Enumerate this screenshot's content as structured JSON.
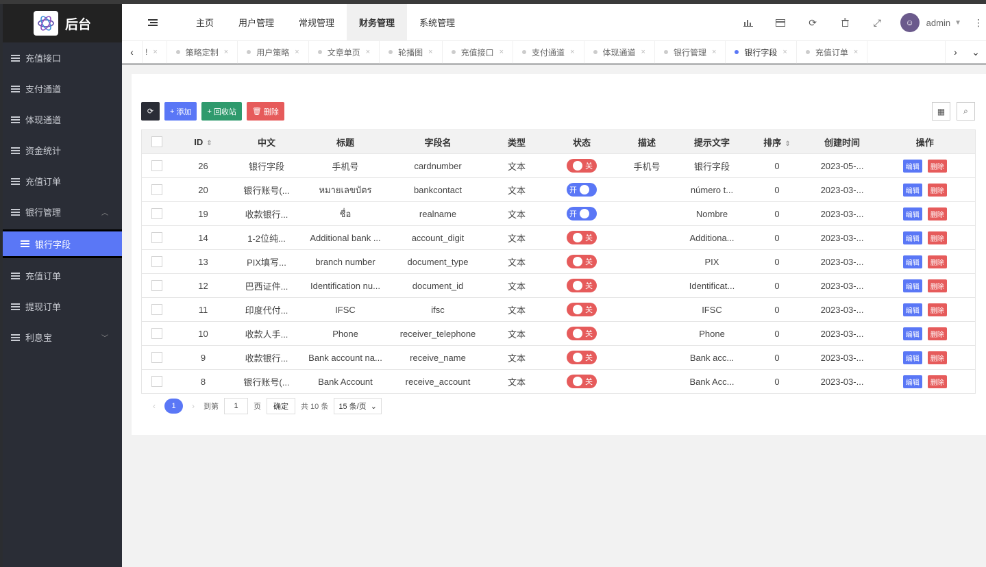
{
  "app": {
    "logo_text": "后台"
  },
  "sidebar": {
    "items": [
      {
        "label": "充值接口"
      },
      {
        "label": "支付通道"
      },
      {
        "label": "体现通道"
      },
      {
        "label": "资金统计"
      },
      {
        "label": "充值订单"
      },
      {
        "label": "银行管理",
        "arrow": "^"
      },
      {
        "label": "银行字段",
        "sub": true
      },
      {
        "label": "充值订单"
      },
      {
        "label": "提现订单"
      },
      {
        "label": "利息宝",
        "arrow": "v"
      }
    ]
  },
  "header": {
    "nav": [
      "主页",
      "用户管理",
      "常规管理",
      "财务管理",
      "系统管理"
    ],
    "active_nav": "财务管理",
    "user": "admin"
  },
  "tabs": [
    {
      "label": "!",
      "active": false,
      "partial": true
    },
    {
      "label": "策略定制",
      "active": false
    },
    {
      "label": "用户策略",
      "active": false
    },
    {
      "label": "文章单页",
      "active": false
    },
    {
      "label": "轮播图",
      "active": false
    },
    {
      "label": "充值接口",
      "active": false
    },
    {
      "label": "支付通道",
      "active": false
    },
    {
      "label": "体现通道",
      "active": false
    },
    {
      "label": "银行管理",
      "active": false
    },
    {
      "label": "银行字段",
      "active": true
    },
    {
      "label": "充值订单",
      "active": false
    }
  ],
  "toolbar": {
    "add_label": "添加",
    "recycle_label": "回收站",
    "delete_label": "删除"
  },
  "table": {
    "columns": [
      "ID",
      "中文",
      "标题",
      "字段名",
      "类型",
      "状态",
      "描述",
      "提示文字",
      "排序",
      "创建时间",
      "操作"
    ],
    "rows": [
      {
        "id": "26",
        "zh": "银行字段",
        "title": "手机号",
        "field": "cardnumber",
        "type": "文本",
        "status": "关",
        "on": false,
        "desc": "手机号",
        "hint": "银行字段",
        "sort": "0",
        "created": "2023-05-..."
      },
      {
        "id": "20",
        "zh": "银行账号(...",
        "title": "หมายเลขบัตร",
        "field": "bankcontact",
        "type": "文本",
        "status": "开",
        "on": true,
        "desc": "",
        "hint": "número t...",
        "sort": "0",
        "created": "2023-03-..."
      },
      {
        "id": "19",
        "zh": "收款银行...",
        "title": "ชื่อ",
        "field": "realname",
        "type": "文本",
        "status": "开",
        "on": true,
        "desc": "",
        "hint": "Nombre",
        "sort": "0",
        "created": "2023-03-..."
      },
      {
        "id": "14",
        "zh": "1-2位纯...",
        "title": "Additional bank ...",
        "field": "account_digit",
        "type": "文本",
        "status": "关",
        "on": false,
        "desc": "",
        "hint": "Additiona...",
        "sort": "0",
        "created": "2023-03-..."
      },
      {
        "id": "13",
        "zh": "PIX填写...",
        "title": "branch number",
        "field": "document_type",
        "type": "文本",
        "status": "关",
        "on": false,
        "desc": "",
        "hint": "PIX",
        "sort": "0",
        "created": "2023-03-..."
      },
      {
        "id": "12",
        "zh": "巴西证件...",
        "title": "Identification nu...",
        "field": "document_id",
        "type": "文本",
        "status": "关",
        "on": false,
        "desc": "",
        "hint": "Identificat...",
        "sort": "0",
        "created": "2023-03-..."
      },
      {
        "id": "11",
        "zh": "印度代付...",
        "title": "IFSC",
        "field": "ifsc",
        "type": "文本",
        "status": "关",
        "on": false,
        "desc": "",
        "hint": "IFSC",
        "sort": "0",
        "created": "2023-03-..."
      },
      {
        "id": "10",
        "zh": "收款人手...",
        "title": "Phone",
        "field": "receiver_telephone",
        "type": "文本",
        "status": "关",
        "on": false,
        "desc": "",
        "hint": "Phone",
        "sort": "0",
        "created": "2023-03-..."
      },
      {
        "id": "9",
        "zh": "收款银行...",
        "title": "Bank account na...",
        "field": "receive_name",
        "type": "文本",
        "status": "关",
        "on": false,
        "desc": "",
        "hint": "Bank acc...",
        "sort": "0",
        "created": "2023-03-..."
      },
      {
        "id": "8",
        "zh": "银行账号(...",
        "title": "Bank Account",
        "field": "receive_account",
        "type": "文本",
        "status": "关",
        "on": false,
        "desc": "",
        "hint": "Bank Acc...",
        "sort": "0",
        "created": "2023-03-..."
      }
    ],
    "edit_label": "编辑",
    "delete_label": "删除"
  },
  "pager": {
    "current": "1",
    "goto_label": "到第",
    "page_input": "1",
    "page_unit": "页",
    "confirm_label": "确定",
    "total": "共 10 条",
    "per_page": "15 条/页"
  },
  "colors": {
    "accent": "#5a77f6",
    "danger": "#e65b5b",
    "success": "#2f9a6d",
    "sidebar": "#2a2d36"
  }
}
